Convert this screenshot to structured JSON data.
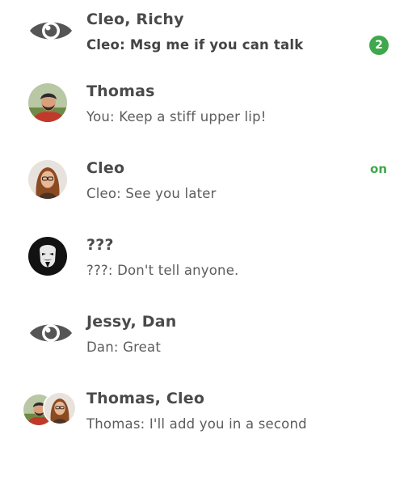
{
  "chats": [
    {
      "title": "Cleo, Richy",
      "preview": "Cleo: Msg me if you can talk",
      "unread": "2",
      "avatar": "eye-icon"
    },
    {
      "title": "Thomas",
      "preview": "You: Keep a stiff upper lip!",
      "avatar": "avatar-thomas"
    },
    {
      "title": "Cleo",
      "preview": "Cleo: See you later",
      "status": "on",
      "avatar": "avatar-cleo"
    },
    {
      "title": "???",
      "preview": "???: Don't tell anyone.",
      "avatar": "avatar-anonymous-mask"
    },
    {
      "title": "Jessy, Dan",
      "preview": "Dan: Great",
      "avatar": "eye-icon"
    },
    {
      "title": "Thomas, Cleo",
      "preview": "Thomas: I'll add you in a second",
      "avatar": "avatar-group-thomas-cleo"
    }
  ],
  "colors": {
    "accent": "#3fa74c",
    "title": "#4a4a4a",
    "preview": "#5c5c5c",
    "eye_icon": "#555555"
  }
}
